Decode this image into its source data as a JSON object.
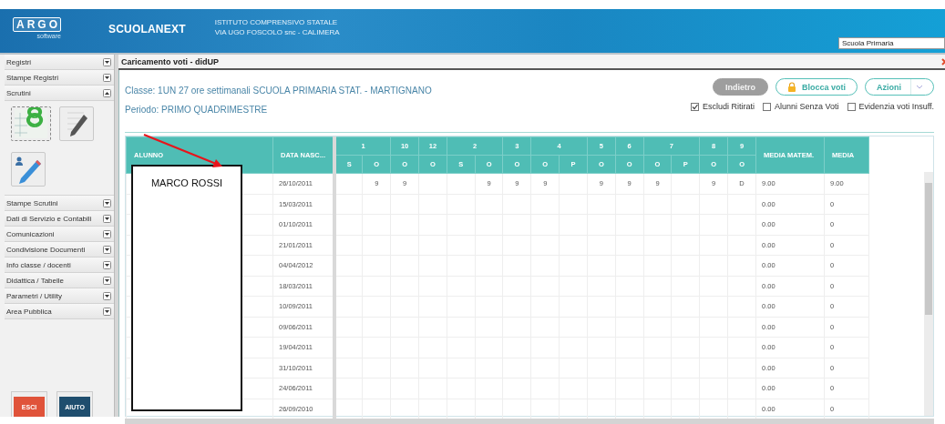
{
  "header": {
    "logo": "ARGO",
    "logo_subtitle": "software",
    "product": "SCUOLANEXT",
    "school_lines": [
      "ISTITUTO COMPRENSIVO STATALE",
      "VIA UGO FOSCOLO snc - CALIMERA"
    ],
    "school_selector": {
      "value": "Scuola Primaria"
    }
  },
  "sidebar": {
    "items": [
      {
        "label": "Registri",
        "expanded": false
      },
      {
        "label": "Stampe Registri",
        "expanded": false
      },
      {
        "label": "Scrutini",
        "expanded": true,
        "tiles": [
          {
            "kind": "grades"
          },
          {
            "kind": "edit"
          },
          {
            "kind": "student-edit"
          }
        ]
      },
      {
        "label": "Stampe Scrutini",
        "expanded": false
      },
      {
        "label": "Dati di Servizio e Contabili",
        "expanded": false
      },
      {
        "label": "Comunicazioni",
        "expanded": false
      },
      {
        "label": "Condivisione Documenti",
        "expanded": false
      },
      {
        "label": "Info classe / docenti",
        "expanded": false
      },
      {
        "label": "Didattica / Tabelle",
        "expanded": false
      },
      {
        "label": "Parametri / Utility",
        "expanded": false
      },
      {
        "label": "Area Pubblica",
        "expanded": false
      }
    ],
    "bottom_buttons": [
      {
        "label": "ESCI",
        "color": "#e0533a"
      },
      {
        "label": "AIUTO",
        "color": "#1f4e6e"
      }
    ]
  },
  "panel": {
    "title": "Caricamento voti - didUP",
    "class_info": "Classe: 1UN 27 ore settimanali SCUOLA PRIMARIA STAT. - MARTIGNANO",
    "period": "Periodo: PRIMO QUADRIMESTRE",
    "buttons": [
      {
        "label": "Indietro",
        "kind": "plain",
        "disabled": true
      },
      {
        "label": "Blocca voti",
        "kind": "lock",
        "disabled": false
      },
      {
        "label": "Azioni",
        "kind": "menu",
        "disabled": false
      }
    ],
    "checkboxes": [
      {
        "label": "Escludi Ritirati",
        "checked": true
      },
      {
        "label": "Alunni Senza Voti",
        "checked": false
      },
      {
        "label": "Evidenzia voti Insuff.",
        "checked": false
      }
    ],
    "table": {
      "columns": [
        "ALUNNO",
        "DATA NASC..."
      ],
      "groups": [
        {
          "label": "1",
          "sub": [
            "S",
            "O"
          ]
        },
        {
          "label": "10",
          "sub": [
            "O"
          ]
        },
        {
          "label": "12",
          "sub": [
            "O"
          ]
        },
        {
          "label": "2",
          "sub": [
            "S",
            "O"
          ]
        },
        {
          "label": "3",
          "sub": [
            "O"
          ]
        },
        {
          "label": "4",
          "sub": [
            "O",
            "P"
          ]
        },
        {
          "label": "5",
          "sub": [
            "O"
          ]
        },
        {
          "label": "6",
          "sub": [
            "O"
          ]
        },
        {
          "label": "7",
          "sub": [
            "O",
            "P"
          ]
        },
        {
          "label": "8",
          "sub": [
            "O"
          ]
        },
        {
          "label": "9",
          "sub": [
            "O"
          ]
        }
      ],
      "average_columns": [
        "MEDIA MATEM.",
        "MEDIA"
      ],
      "rows": [
        {
          "birth_date": "26/10/2011",
          "grades": [
            {
              "kind": "empty"
            },
            {
              "kind": "grade",
              "value": "9"
            },
            {
              "kind": "grade",
              "value": "9"
            },
            {
              "kind": "empty"
            },
            {
              "kind": "empty"
            },
            {
              "kind": "grade",
              "value": "9"
            },
            {
              "kind": "grade",
              "value": "9"
            },
            {
              "kind": "grade",
              "value": "9"
            },
            {
              "kind": "empty"
            },
            {
              "kind": "grade",
              "value": "9"
            },
            {
              "kind": "grade",
              "value": "9"
            },
            {
              "kind": "grade",
              "value": "9"
            },
            {
              "kind": "empty"
            },
            {
              "kind": "grade",
              "value": "9"
            },
            {
              "kind": "grade",
              "value": "D"
            }
          ],
          "media_matem": "9.00",
          "media": "9.00"
        },
        {
          "birth_date": "15/03/2011",
          "media_matem": "0.00",
          "media": "0"
        },
        {
          "birth_date": "01/10/2011",
          "media_matem": "0.00",
          "media": "0"
        },
        {
          "birth_date": "21/01/2011",
          "media_matem": "0.00",
          "media": "0"
        },
        {
          "birth_date": "04/04/2012",
          "media_matem": "0.00",
          "media": "0"
        },
        {
          "birth_date": "18/03/2011",
          "media_matem": "0.00",
          "media": "0"
        },
        {
          "birth_date": "10/09/2011",
          "media_matem": "0.00",
          "media": "0"
        },
        {
          "birth_date": "09/06/2011",
          "media_matem": "0.00",
          "media": "0"
        },
        {
          "birth_date": "19/04/2011",
          "media_matem": "0.00",
          "media": "0"
        },
        {
          "birth_date": "31/10/2011",
          "media_matem": "0.00",
          "media": "0"
        },
        {
          "birth_date": "24/06/2011",
          "media_matem": "0.00",
          "media": "0"
        },
        {
          "birth_date": "26/09/2010",
          "media_matem": "0.00",
          "media": "0"
        }
      ]
    }
  },
  "annotation": {
    "text": "MARCO ROSSI"
  }
}
